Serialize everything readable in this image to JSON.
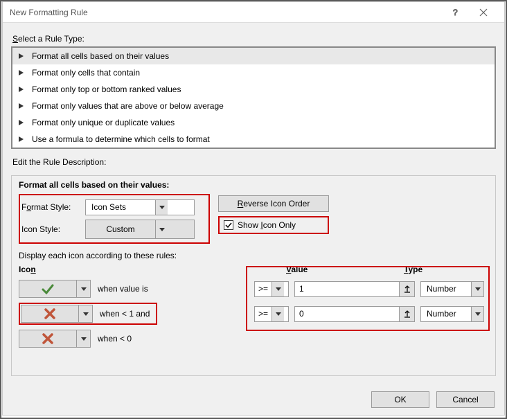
{
  "titlebar": {
    "title": "New Formatting Rule"
  },
  "sections": {
    "select_rule_type": "Select a Rule Type:",
    "edit_desc": "Edit the Rule Description:",
    "group_title": "Format all cells based on their values:"
  },
  "rule_types": [
    "Format all cells based on their values",
    "Format only cells that contain",
    "Format only top or bottom ranked values",
    "Format only values that are above or below average",
    "Format only unique or duplicate values",
    "Use a formula to determine which cells to format"
  ],
  "labels": {
    "format_style": "Format Style:",
    "icon_style": "Icon Style:",
    "reverse": "Reverse Icon Order",
    "show_icon_only": "Show Icon Only",
    "display_each": "Display each icon according to these rules:",
    "icon_header": "Icon",
    "value_header": "Value",
    "type_header": "Type"
  },
  "values": {
    "format_style": "Icon Sets",
    "icon_style": "Custom",
    "show_icon_only_checked": true
  },
  "icon_rules": [
    {
      "icon": "check",
      "cond": "when value is",
      "op": ">=",
      "value": "1",
      "type": "Number"
    },
    {
      "icon": "cross",
      "cond": "when < 1 and",
      "op": ">=",
      "value": "0",
      "type": "Number"
    },
    {
      "icon": "cross",
      "cond": "when < 0"
    }
  ],
  "buttons": {
    "ok": "OK",
    "cancel": "Cancel"
  }
}
